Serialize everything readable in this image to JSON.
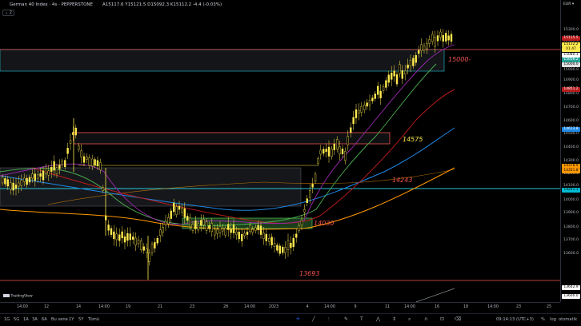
{
  "header": {
    "symbol": "German 40 Index · 4s · PEPPERSTONE",
    "ohlc": "A15117.6  Y15121.5  D15092.3  K15112.2  -4.4 (-0.03%)",
    "collapse_button": "⌄ 2"
  },
  "price_axis": {
    "currency": "EUR ▾",
    "ticks": [
      "15300.0",
      "15200.0",
      "15100.0",
      "15000.0",
      "14900.0",
      "14800.0",
      "14700.0",
      "14600.0",
      "14500.0",
      "14400.0",
      "14300.0",
      "14200.0",
      "14100.0",
      "14000.0",
      "13900.0",
      "13800.0",
      "13700.0",
      "13600.0"
    ],
    "badges": [
      {
        "label": "15115.5",
        "color": "#b71c1c",
        "text_color": "#ffffff"
      },
      {
        "label": "15112.2",
        "color": "#ffe94d",
        "text_color": "#000000"
      },
      {
        "label": "01:47",
        "color": "#ffe94d",
        "text_color": "#000000"
      },
      {
        "label": "15080.1",
        "color": "#ffffff",
        "text_color": "#000000"
      },
      {
        "label": "15058.2",
        "color": "#26a69a",
        "text_color": "#ffffff"
      },
      {
        "label": "15000.0",
        "color": "#e0e0e0",
        "text_color": "#000000"
      },
      {
        "label": "14851.2",
        "color": "#b71c1c",
        "text_color": "#ffffff"
      },
      {
        "label": "14613.8",
        "color": "#1e88e5",
        "text_color": "#ffffff"
      },
      {
        "label": "14378.9",
        "color": "#ff9800",
        "text_color": "#000000"
      },
      {
        "label": "14351.8",
        "color": "#ff9800",
        "text_color": "#000000"
      },
      {
        "label": "14241.1",
        "color": "#00bcd4",
        "text_color": "#000000"
      },
      {
        "label": "13642.9",
        "color": "#ffffff",
        "text_color": "#000000"
      },
      {
        "label": "13600.0",
        "color": "#ffffff",
        "text_color": "#000000"
      }
    ]
  },
  "time_axis": {
    "labels": [
      "14:00",
      "12",
      "14",
      "14:00",
      "19",
      "21",
      "23",
      "28",
      "14:00",
      "2023",
      "4",
      "14:00",
      "9",
      "11",
      "14:00",
      "16",
      "18",
      "14:00",
      "23",
      "25"
    ]
  },
  "annotations": {
    "level_15000": "15000-",
    "level_14575": "14575",
    "level_14243": "14243",
    "level_14030": "14030",
    "level_13693": "13693"
  },
  "watermark": "TradingView",
  "bottom_bar": {
    "ranges": [
      "1G",
      "5G",
      "1A",
      "3A",
      "6A",
      "Bu sene",
      "1Y",
      "5Y",
      "Tümü"
    ],
    "time": "09:14:13 (UTC+3)",
    "pct": "%",
    "log": "log",
    "auto": "otomatik"
  },
  "colors": {
    "background": "#000000",
    "candle": "#ffe94d",
    "resistance_line": "#ef5350",
    "support_line": "#26c6da",
    "ma_fast": "#9c27b0",
    "ma_mid": "#4caf50",
    "ma_red": "#b71c1c",
    "ma_blue": "#1e88e5",
    "ma_orange": "#ff9800",
    "zone_fill": "rgba(120,130,150,0.18)",
    "zone_green": "rgba(76,175,80,0.35)"
  }
}
